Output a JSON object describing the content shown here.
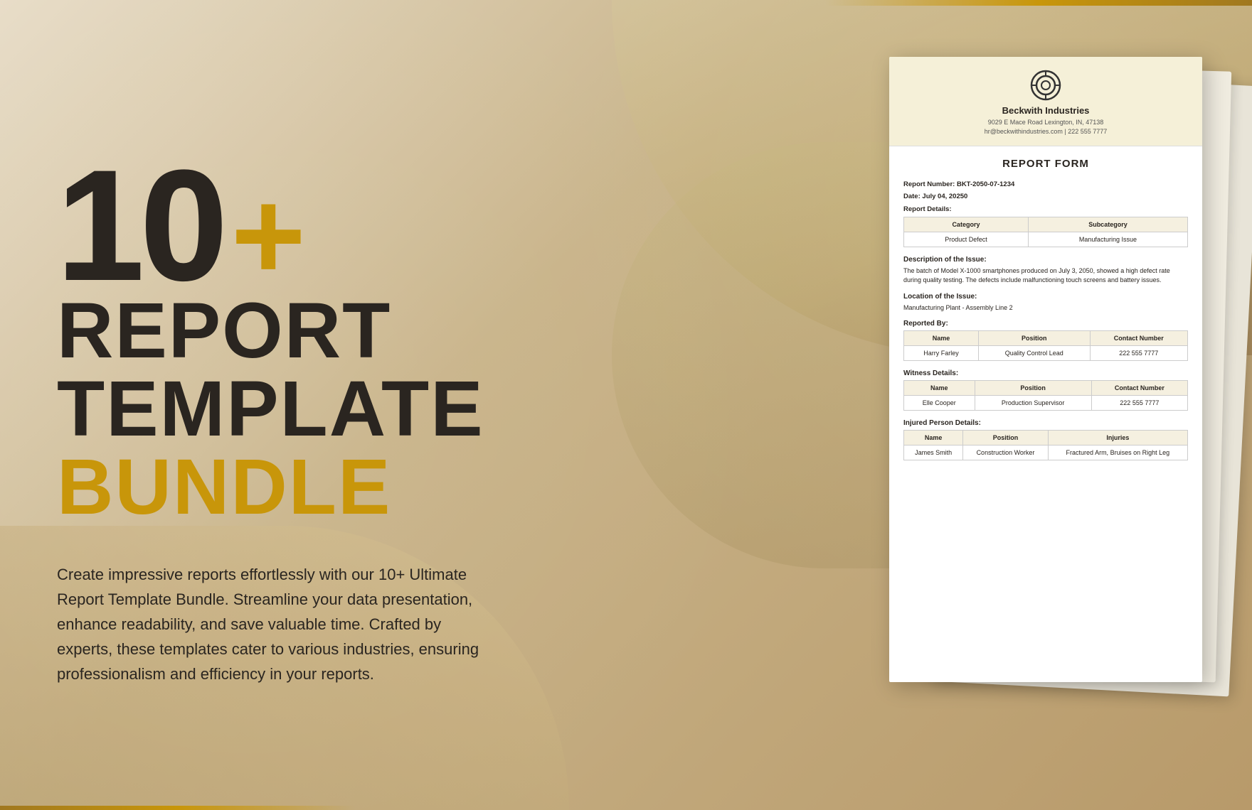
{
  "background": {
    "color_main": "#c9b48a",
    "color_accent": "#c8960a"
  },
  "hero": {
    "number": "10",
    "plus": "+",
    "line2": "REPORT",
    "line3": "TEMPLATE",
    "line4": "BUNDLE",
    "description": "Create impressive reports effortlessly with our 10+ Ultimate Report Template Bundle. Streamline your data presentation, enhance readability, and save valuable time. Crafted by experts, these templates cater to various industries, ensuring professionalism and efficiency in your reports."
  },
  "document": {
    "company_name": "Beckwith Industries",
    "company_address": "9029 E Mace Road Lexington, IN, 47138",
    "company_contact": "hr@beckwithindustries.com | 222 555 7777",
    "form_title": "REPORT FORM",
    "report_number_label": "Report Number:",
    "report_number": "BKT-2050-07-1234",
    "date_label": "Date:",
    "date_value": "July 04, 20250",
    "report_details_label": "Report Details:",
    "category_table": {
      "headers": [
        "Category",
        "Subcategory"
      ],
      "rows": [
        [
          "Product Defect",
          "Manufacturing Issue"
        ]
      ]
    },
    "description_title": "Description of the Issue:",
    "description_text": "The batch of Model X-1000 smartphones produced on July 3, 2050, showed a high defect rate during quality testing. The defects include malfunctioning touch screens and battery issues.",
    "location_title": "Location of the Issue:",
    "location_text": "Manufacturing Plant - Assembly Line 2",
    "reported_by_title": "Reported By:",
    "reported_by_table": {
      "headers": [
        "Name",
        "Position",
        "Contact Number"
      ],
      "rows": [
        [
          "Harry Farley",
          "Quality Control Lead",
          "222 555 7777"
        ]
      ]
    },
    "witness_title": "Witness Details:",
    "witness_table": {
      "headers": [
        "Name",
        "Position",
        "Contact Number"
      ],
      "rows": [
        [
          "Elle Cooper",
          "Production Supervisor",
          "222 555 7777"
        ]
      ]
    },
    "injured_title": "Injured Person Details:",
    "injured_table": {
      "headers": [
        "Name",
        "Position",
        "Injuries"
      ],
      "rows": [
        [
          "James Smith",
          "Construction Worker",
          "Fractured Arm, Bruises on Right Leg"
        ]
      ]
    }
  }
}
